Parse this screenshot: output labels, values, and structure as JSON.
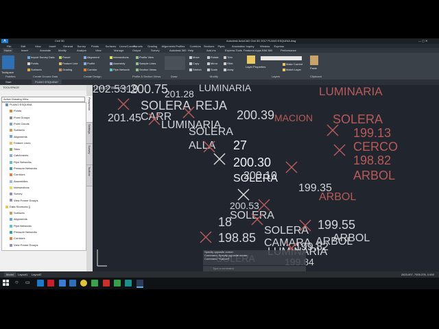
{
  "titlebar": {
    "quick": "Civil 3D",
    "title": "Autodesk AutoCAD Civil 3D 2017  PLANO ESQUINA.dwg"
  },
  "menu": [
    "File",
    "Edit",
    "View",
    "Insert",
    "General",
    "Survey",
    "Points",
    "Surfaces",
    "Lines/Curves",
    "Parcels",
    "Grading",
    "Alignments",
    "Profiles",
    "Corridors",
    "Sections",
    "Pipes",
    "Annotation",
    "Inquiry",
    "Window",
    "Express"
  ],
  "ribbon_tabs": [
    "Home",
    "Insert",
    "Annotate",
    "Modify",
    "Analyze",
    "View",
    "Manage",
    "Output",
    "Survey",
    "Autodesk 360",
    "Help",
    "Add-ins",
    "Express Tools",
    "Featured Apps",
    "BIM 360",
    "Performance"
  ],
  "ribbon": {
    "toolspace": "Toolspace",
    "import_survey": "Import Survey Data",
    "points": "Points",
    "surfaces": "Surfaces",
    "parcel": "Parcel",
    "feature_line": "Feature Line",
    "grading": "Grading",
    "alignment": "Alignment",
    "profile": "Profile",
    "corridor": "Corridor",
    "intersections": "Intersections",
    "assembly": "Assembly",
    "pipe_network": "Pipe Network",
    "profile_view": "Profile View",
    "sample_lines": "Sample Lines",
    "section_views": "Section Views",
    "move": "Move",
    "rotate": "Rotate",
    "copy": "Copy",
    "mirror": "Mirror",
    "stretch": "Stretch",
    "scale": "Scale",
    "trim": "Trim",
    "fillet": "Fillet",
    "array": "Array",
    "layer_properties": "Layer Properties",
    "make_current": "Make Current",
    "match_layer": "Match Layer",
    "paste": "Paste",
    "panels": [
      "Palettes",
      "Create Ground Data",
      "Create Design",
      "Profile & Section Views",
      "Draw",
      "Modify",
      "Layers",
      "Clipboard"
    ]
  },
  "file_tabs": [
    "Start",
    "PLANO ESQUINA*"
  ],
  "toolspace": {
    "title": "TOOLSPACE",
    "view_selector": "Active Drawing View",
    "tree": [
      "PLANO ESQUINA",
      "Points",
      "Point Groups",
      "Point Clouds",
      "Surfaces",
      "Alignments",
      "Feature Lines",
      "Sites",
      "Catchments",
      "Pipe Networks",
      "Pressure Networks",
      "Corridors",
      "Assemblies",
      "Intersections",
      "Survey",
      "View Frame Groups",
      "Data Shortcuts []",
      "Surfaces",
      "Alignments",
      "Pipe Networks",
      "Pressure Networks",
      "Corridors",
      "View Frame Groups"
    ],
    "vtabs": [
      "Prospector",
      "Settings",
      "Survey",
      "Toolbox"
    ]
  },
  "viewport": {
    "label": "[-][Top][2D Wireframe]",
    "texts_white": [
      "202.5319",
      "200.75",
      "SOLERA",
      "LUMINARIA",
      "200.39",
      "REJA",
      "201.45",
      "CARR",
      "201.28",
      "SOLERA",
      "ALLA",
      "LUMINARIA",
      "27",
      "200.30",
      "SOLERA",
      "200.10",
      "199.35",
      "18",
      "200.53",
      "199.55",
      "SOLERA",
      "ARBOL",
      "198.85",
      "SOLERA",
      "CAMARA",
      "199.82",
      "ARBOL",
      "LUMINARIA",
      "199.84",
      "SOLERA"
    ],
    "texts_red": [
      "LUMINARIA",
      "SOLERA",
      "199.13",
      "CERCO",
      "198.82",
      "ARBOL",
      "MACION",
      "ARBOL"
    ]
  },
  "command": {
    "history": [
      "Specify opposite corner:",
      "Command: Specify opposite corner:",
      "Command: *Cancel*"
    ],
    "placeholder": "Type a command"
  },
  "status": {
    "layout_tabs": [
      "Model",
      "Layout1",
      "Layout2"
    ],
    "coords": "2823.007, 7005.378, 0.000"
  },
  "colors": {
    "canvas": "#21262e",
    "red_marks": "#b85a5a",
    "accent": "#1e78c8"
  }
}
